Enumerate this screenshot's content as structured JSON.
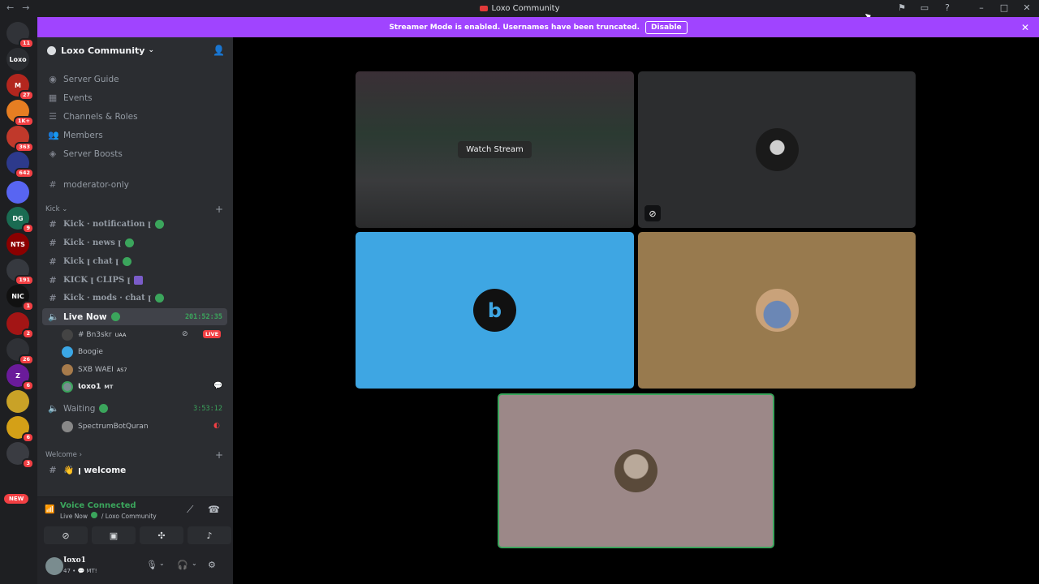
{
  "window": {
    "title": "Loxo Community",
    "back": "←",
    "forward": "→",
    "icons": [
      "pin-icon",
      "inbox-icon",
      "help-icon",
      "minimize-icon",
      "maximize-icon",
      "close-icon"
    ]
  },
  "banner": {
    "text": "Streamer Mode is enabled. Usernames have been truncated.",
    "button": "Disable"
  },
  "rail": {
    "servers": [
      {
        "label": "",
        "badge": "11",
        "color": "#313338"
      },
      {
        "label": "Loxo",
        "badge": "",
        "color": "#2b2d31"
      },
      {
        "label": "M",
        "badge": "27",
        "color": "#b3261e"
      },
      {
        "label": "",
        "badge": "1K+",
        "color": "#e67e22"
      },
      {
        "label": "",
        "badge": "363",
        "color": "#c0392b"
      },
      {
        "label": "",
        "badge": "642",
        "color": "#2d3a8c"
      },
      {
        "label": "",
        "badge": "",
        "color": "#5865f2"
      },
      {
        "label": "DG",
        "badge": "9",
        "color": "#1a6b52"
      },
      {
        "label": "NTS",
        "badge": "",
        "color": "#8b0000"
      },
      {
        "label": "",
        "badge": "191",
        "color": "#36393f"
      },
      {
        "label": "NIC",
        "badge": "1",
        "color": "#111111"
      },
      {
        "label": "",
        "badge": "2",
        "color": "#a31515"
      },
      {
        "label": "",
        "badge": "26",
        "color": "#2f3136"
      },
      {
        "label": "Z",
        "badge": "6",
        "color": "#6a1b9a"
      },
      {
        "label": "",
        "badge": "",
        "color": "#c9a227"
      },
      {
        "label": "",
        "badge": "6",
        "color": "#d4a017"
      },
      {
        "label": "",
        "badge": "3",
        "color": "#3a3c42"
      }
    ],
    "new_label": "NEW"
  },
  "sidebar": {
    "server_name": "Loxo Community",
    "menu": [
      {
        "label": "Server Guide",
        "icon": "compass-icon"
      },
      {
        "label": "Events",
        "icon": "calendar-icon"
      },
      {
        "label": "Channels & Roles",
        "icon": "list-icon"
      },
      {
        "label": "Members",
        "icon": "members-icon"
      },
      {
        "label": "Server Boosts",
        "icon": "boost-icon"
      }
    ],
    "moderator": "moderator-only",
    "kick_category": "Kick",
    "kick_channels": [
      "Kick · notification ꞁ",
      "Kick · news ꞁ",
      "Kick ꞁ chat ꞁ",
      "KICK ꞁ CLIPS ꞁ",
      "Kick · mods · chat ꞁ"
    ],
    "live_now": {
      "label": "Live Now",
      "timer": "201:52:35"
    },
    "voice_users": [
      {
        "name": "# Bn3skr",
        "tag": "UAA",
        "live": "LIVE",
        "avatar": "#444"
      },
      {
        "name": "Boogie",
        "tag": "",
        "live": "",
        "avatar": "#3ba7e6"
      },
      {
        "name": "SXB WAEI",
        "tag": "AS7",
        "live": "",
        "avatar": "#a77b4b"
      },
      {
        "name": "Ɩoxo1",
        "tag": "MT",
        "live": "",
        "avatar": "#7a8c8f"
      }
    ],
    "waiting": {
      "label": "Waiting",
      "timer": "3:53:12"
    },
    "waiting_users": [
      {
        "name": "SpectrumBotQuran",
        "avatar": "#888"
      }
    ],
    "welcome_category": "Welcome",
    "welcome_channel": "ꞁ welcome"
  },
  "voice": {
    "title": "Voice Connected",
    "sub1": "Live Now",
    "sub2": "/ Loxo Community"
  },
  "user": {
    "name": "Ɩoxo1",
    "status": "47 • 💬 MT!"
  },
  "stage": {
    "watch_label": "Watch Stream",
    "tiles": [
      {
        "bg": "#2c2d2f",
        "avatar": "#1a1a1a"
      },
      {
        "bg": "#3ea6e3",
        "avatar": "#111"
      },
      {
        "bg": "#987a4e",
        "avatar": "#6b87b5"
      },
      {
        "bg": "#9c8888",
        "avatar": "#6b5a4a"
      }
    ]
  }
}
